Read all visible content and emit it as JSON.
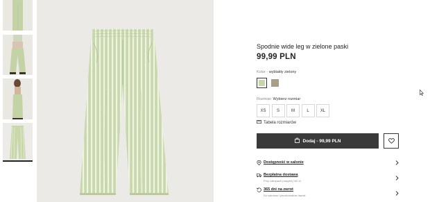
{
  "thumbnails": [
    "back-view",
    "worn-front",
    "worn-side",
    "flat-front"
  ],
  "product": {
    "title": "Spodnie wide leg w zielone paski",
    "price": "99,99 PLN"
  },
  "color": {
    "label": "Kolor",
    "separator": "-",
    "value": "wyblakły zielony",
    "swatches": [
      "#c6d6a8",
      "#a79f88"
    ]
  },
  "size": {
    "label": "Rozmiar",
    "separator": ":",
    "value": "Wybierz rozmiar",
    "options": [
      "XS",
      "S",
      "M",
      "L",
      "XL"
    ]
  },
  "size_table": {
    "label": "Tabela rozmiarów",
    "icon": "ruler-icon"
  },
  "add_to_cart": {
    "label": "Dodaj - 99,99 PLN",
    "icon": "shopping-bag-icon"
  },
  "wishlist": {
    "icon": "heart-icon"
  },
  "services": [
    {
      "icon": "pin-icon",
      "title": "Dostępność w salonie",
      "subtitle": ""
    },
    {
      "icon": "truck-icon",
      "title": "Bezpłatna dostawa",
      "subtitle": "Przy zakupach powyżej 140 zł"
    },
    {
      "icon": "return-icon",
      "title": "365 dni na zwrot",
      "subtitle": "Do salonów i paczkomatów Inpost"
    }
  ],
  "colors": {
    "primary_button": "#3a3a3a",
    "product_green": "#c6d6a8",
    "image_background": "#ebeae6"
  }
}
